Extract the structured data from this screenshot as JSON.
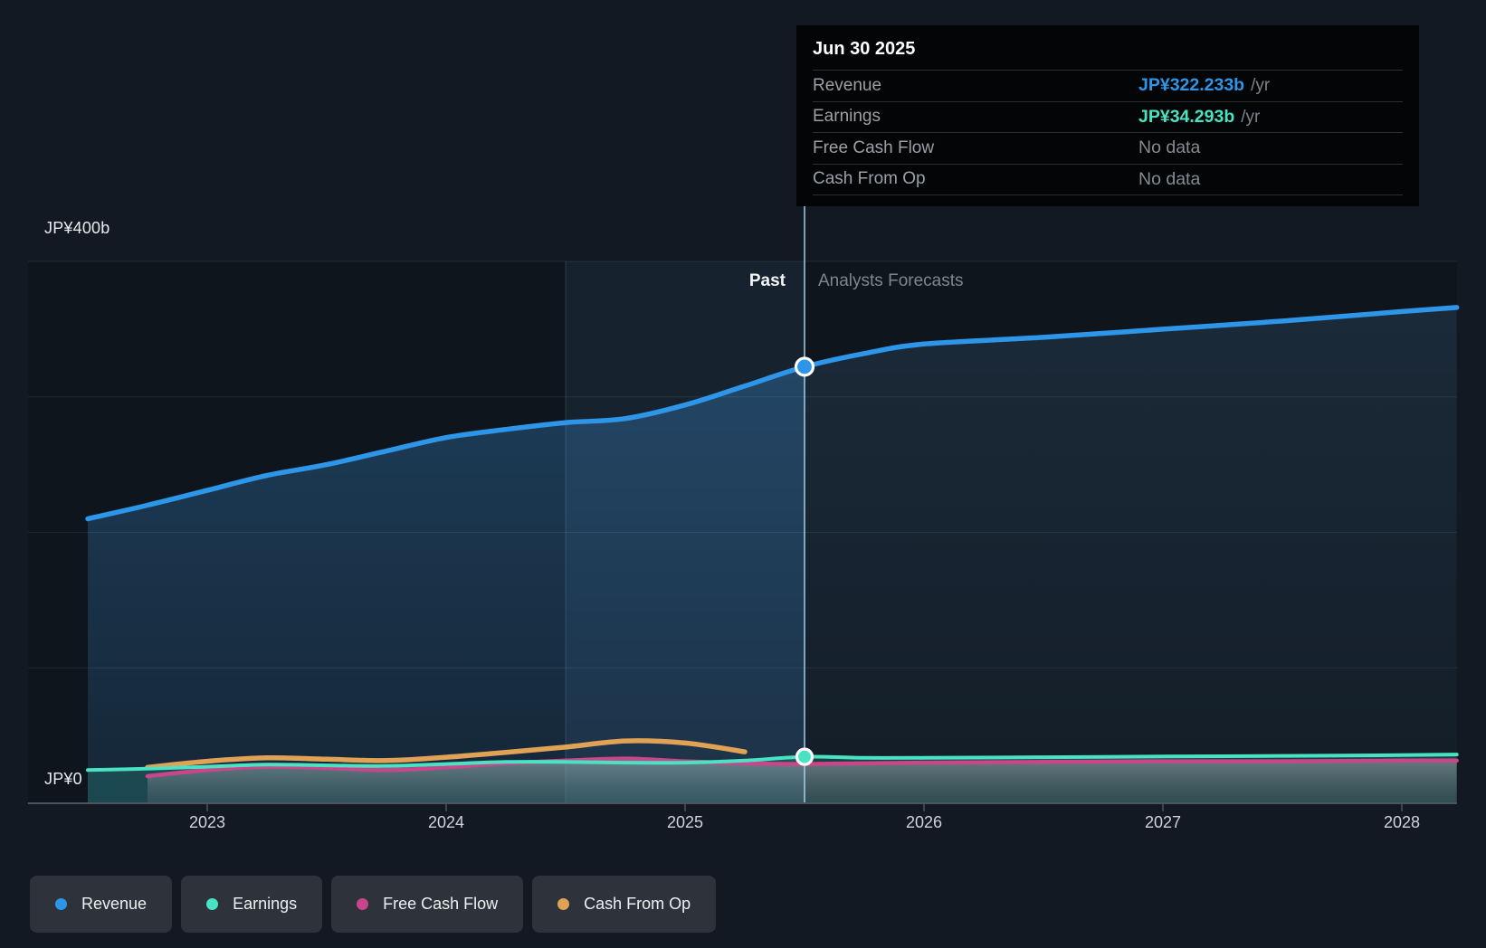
{
  "tooltip": {
    "date": "Jun 30 2025",
    "rows": [
      {
        "label": "Revenue",
        "value": "JP¥322.233b",
        "suffix": "/yr",
        "color": "#2d96e8",
        "no_data": false
      },
      {
        "label": "Earnings",
        "value": "JP¥34.293b",
        "suffix": "/yr",
        "color": "#49e3c3",
        "no_data": false
      },
      {
        "label": "Free Cash Flow",
        "value": "No data",
        "suffix": "",
        "color": "#858b91",
        "no_data": true
      },
      {
        "label": "Cash From Op",
        "value": "No data",
        "suffix": "",
        "color": "#858b91",
        "no_data": true
      }
    ]
  },
  "chart": {
    "y_axis_top_label": "JP¥400b",
    "y_axis_zero_label": "JP¥0",
    "past_label": "Past",
    "forecast_label": "Analysts Forecasts"
  },
  "legend": [
    {
      "label": "Revenue",
      "color": "#2d96e8"
    },
    {
      "label": "Earnings",
      "color": "#49e3c3"
    },
    {
      "label": "Free Cash Flow",
      "color": "#c9468b"
    },
    {
      "label": "Cash From Op",
      "color": "#e0a356"
    }
  ],
  "chart_data": {
    "type": "line",
    "title": "",
    "xlabel": "",
    "ylabel": "JP¥ billions",
    "ylim": [
      0,
      400
    ],
    "gridline_values": [
      0,
      100,
      200,
      300,
      400
    ],
    "x_unit": "calendar year",
    "x_ticks": [
      2023,
      2024,
      2025,
      2026,
      2027,
      2028
    ],
    "x_range": [
      2022.25,
      2028.23
    ],
    "divider_x": 2025.5,
    "divider_date": "Jun 30 2025",
    "highlight_band": [
      2024.5,
      2025.5
    ],
    "legend_position": "bottom-left",
    "grid": true,
    "series": [
      {
        "name": "Revenue",
        "color": "#2d96e8",
        "width": 5.5,
        "past": [
          [
            2022.5,
            210
          ],
          [
            2022.75,
            220
          ],
          [
            2023.0,
            231
          ],
          [
            2023.25,
            242
          ],
          [
            2023.5,
            250
          ],
          [
            2023.75,
            260
          ],
          [
            2024.0,
            270
          ],
          [
            2024.25,
            276
          ],
          [
            2024.5,
            281
          ],
          [
            2024.75,
            284
          ],
          [
            2025.0,
            294
          ],
          [
            2025.25,
            308
          ],
          [
            2025.5,
            322.233
          ]
        ],
        "forecast": [
          [
            2025.5,
            322.233
          ],
          [
            2025.75,
            332
          ],
          [
            2026.0,
            339
          ],
          [
            2026.5,
            344
          ],
          [
            2027.0,
            350
          ],
          [
            2027.5,
            356
          ],
          [
            2028.0,
            363
          ],
          [
            2028.23,
            366
          ]
        ]
      },
      {
        "name": "Earnings",
        "color": "#49e3c3",
        "width": 4,
        "past": [
          [
            2022.5,
            24.5
          ],
          [
            2022.75,
            25.5
          ],
          [
            2023.0,
            27
          ],
          [
            2023.25,
            28.5
          ],
          [
            2023.5,
            28
          ],
          [
            2023.75,
            27.5
          ],
          [
            2024.0,
            29
          ],
          [
            2024.25,
            30.5
          ],
          [
            2024.5,
            30.5
          ],
          [
            2024.75,
            30
          ],
          [
            2025.0,
            30
          ],
          [
            2025.25,
            31.5
          ],
          [
            2025.5,
            34.293
          ]
        ],
        "forecast": [
          [
            2025.5,
            34.293
          ],
          [
            2025.75,
            33.5
          ],
          [
            2026.0,
            33.5
          ],
          [
            2026.5,
            34
          ],
          [
            2027.0,
            34.5
          ],
          [
            2027.5,
            35
          ],
          [
            2028.0,
            35.5
          ],
          [
            2028.23,
            36
          ]
        ]
      },
      {
        "name": "Free Cash Flow",
        "color": "#c9468b",
        "width": 4.5,
        "past": [
          [
            2022.75,
            20
          ],
          [
            2023.0,
            24.5
          ],
          [
            2023.25,
            27
          ],
          [
            2023.5,
            26
          ],
          [
            2023.75,
            24.5
          ],
          [
            2024.0,
            26.5
          ],
          [
            2024.25,
            29.5
          ],
          [
            2024.5,
            31.5
          ],
          [
            2024.75,
            33
          ],
          [
            2025.0,
            31
          ],
          [
            2025.25,
            29.5
          ],
          [
            2025.5,
            29
          ]
        ],
        "forecast": [
          [
            2025.5,
            29
          ],
          [
            2026.0,
            30
          ],
          [
            2026.5,
            30.5
          ],
          [
            2027.0,
            31
          ],
          [
            2027.5,
            31
          ],
          [
            2028.0,
            31.5
          ],
          [
            2028.23,
            31.5
          ]
        ]
      },
      {
        "name": "Cash From Op",
        "color": "#e0a356",
        "width": 5.5,
        "past": [
          [
            2022.75,
            26.5
          ],
          [
            2023.0,
            31
          ],
          [
            2023.25,
            33.5
          ],
          [
            2023.5,
            32.5
          ],
          [
            2023.75,
            31.5
          ],
          [
            2024.0,
            34
          ],
          [
            2024.25,
            37.5
          ],
          [
            2024.5,
            41.5
          ],
          [
            2024.75,
            46
          ],
          [
            2025.0,
            44.5
          ],
          [
            2025.25,
            38
          ]
        ],
        "forecast": []
      }
    ],
    "markers": [
      {
        "series": "Revenue",
        "x": 2025.5,
        "value": 322.233
      },
      {
        "series": "Earnings",
        "x": 2025.5,
        "value": 34.293
      }
    ]
  }
}
